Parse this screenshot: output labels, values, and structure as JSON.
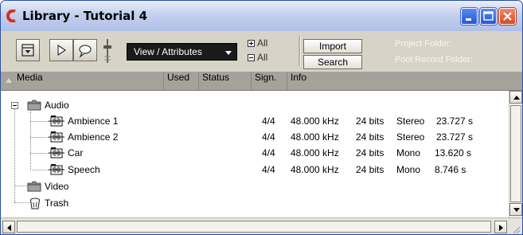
{
  "window": {
    "title": "Library - Tutorial 4",
    "app_icon": "cubase-logo-icon",
    "buttons": [
      "minimize-icon",
      "maximize-icon",
      "close-icon"
    ]
  },
  "toolbar": {
    "view_dropdown": "View / Attributes",
    "expand_all": "All",
    "collapse_all": "All",
    "import_button": "Import",
    "search_button": "Search",
    "project_folder_label": "Project Folder:",
    "pool_record_folder_label": "Pool Record Folder:"
  },
  "columns": [
    "Media",
    "Used",
    "Status",
    "Sign.",
    "Info"
  ],
  "tree": {
    "audio_folder": "Audio",
    "clips": [
      {
        "name": "Ambience 1",
        "sign": "4/4",
        "rate": "48.000 kHz",
        "bits": "24 bits",
        "channels": "Stereo",
        "length": "23.727 s"
      },
      {
        "name": "Ambience 2",
        "sign": "4/4",
        "rate": "48.000 kHz",
        "bits": "24 bits",
        "channels": "Stereo",
        "length": "23.727 s"
      },
      {
        "name": "Car",
        "sign": "4/4",
        "rate": "48.000 kHz",
        "bits": "24 bits",
        "channels": "Mono",
        "length": "13.620 s"
      },
      {
        "name": "Speech",
        "sign": "4/4",
        "rate": "48.000 kHz",
        "bits": "24 bits",
        "channels": "Mono",
        "length": "8.746 s"
      }
    ],
    "video_folder": "Video",
    "trash": "Trash"
  },
  "colors": {
    "title_gradient_top": "#e9eef9",
    "toolbar_bg": "#d7d3c6",
    "header_bg": "#a4a29a",
    "logo_red": "#d8301e"
  }
}
